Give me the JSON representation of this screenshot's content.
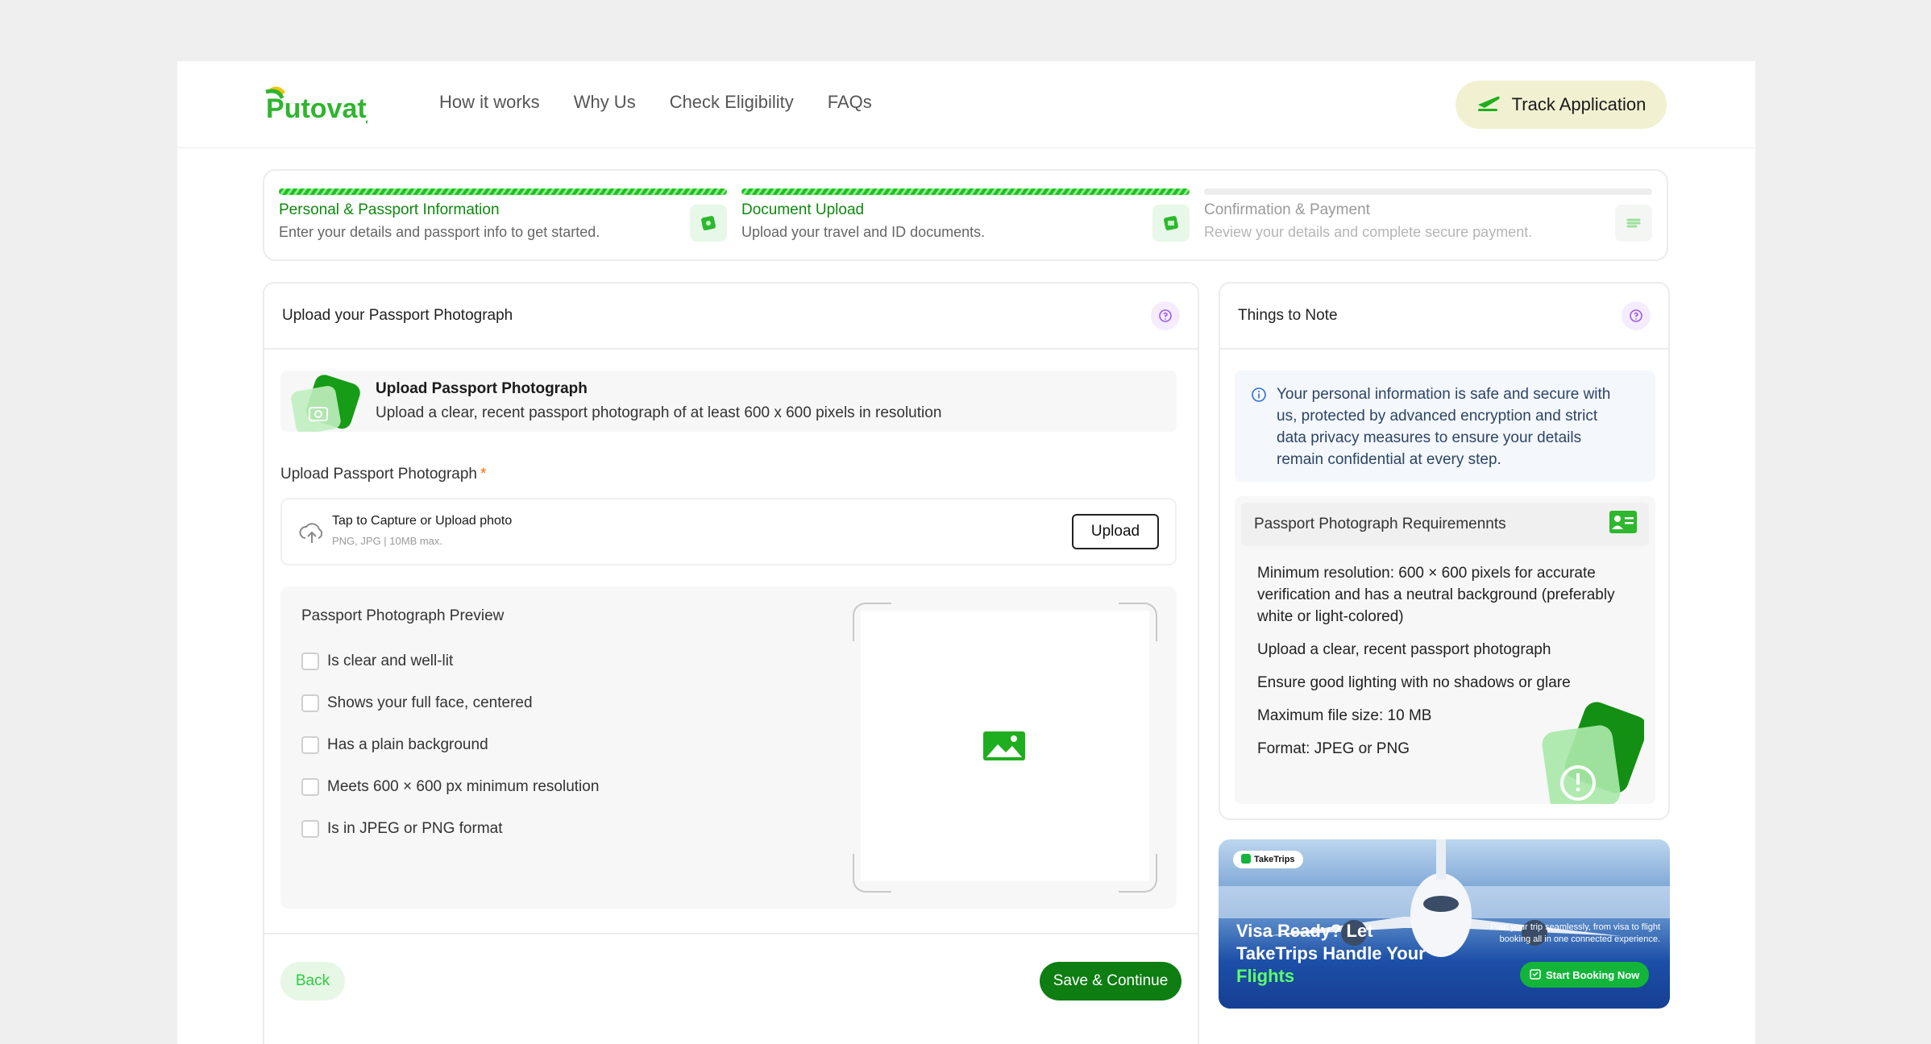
{
  "brand": {
    "logo_text": "Putovatj"
  },
  "nav": {
    "items": [
      "How it works",
      "Why Us",
      "Check Eligibility",
      "FAQs"
    ],
    "track_label": "Track Application"
  },
  "steps": [
    {
      "title": "Personal & Passport Information",
      "desc": "Enter your details and passport info to get started.",
      "state": "done"
    },
    {
      "title": "Document Upload",
      "desc": "Upload your travel and ID documents.",
      "state": "active"
    },
    {
      "title": "Confirmation & Payment",
      "desc": "Review your details and complete secure payment.",
      "state": "pending"
    }
  ],
  "upload_card": {
    "title": "Upload your Passport Photograph",
    "banner_title": "Upload Passport Photograph",
    "banner_desc": "Upload a clear, recent passport photograph of at least 600 x 600 pixels in resolution",
    "field_label": "Upload Passport Photograph",
    "required_mark": "*",
    "drop_title": "Tap to Capture or Upload photo",
    "drop_hint": "PNG, JPG | 10MB max.",
    "upload_label": "Upload",
    "preview_title": "Passport Photograph Preview",
    "checklist": [
      "Is clear and well-lit",
      "Shows your full face, centered",
      "Has a plain background",
      "Meets 600 × 600 px minimum resolution",
      "Is in JPEG or PNG format"
    ],
    "back_label": "Back",
    "save_label": "Save & Continue"
  },
  "notes_card": {
    "title": "Things to Note",
    "security_note": "Your personal information is safe and secure with us, protected by advanced encryption and strict data privacy measures to ensure your details remain confidential at every step.",
    "requirements_title": "Passport Photograph Requiremennts",
    "requirements": [
      {
        "label": "Minimum resolution: ",
        "value": "600 × 600",
        "rest": " pixels for accurate verification and has a neutral background (preferably white or light-colored)"
      },
      {
        "label": "Upload a clear, recent passport photograph",
        "value": "",
        "rest": ""
      },
      {
        "label": "Ensure good lighting with no shadows or glare",
        "value": "",
        "rest": ""
      },
      {
        "label": "Maximum file size: ",
        "value": "10 MB",
        "rest": ""
      },
      {
        "label": "Format: ",
        "value": "JPEG or PNG",
        "rest": ""
      }
    ]
  },
  "ad": {
    "brand": "TakeTrips",
    "headline_1": "Visa Ready? Let TakeTrips Handle Your ",
    "headline_2": "Flights",
    "sub": "Plan your trip seamlessly, from visa to flight booking all in one connected experience.",
    "cta": "Start Booking Now"
  },
  "colors": {
    "accent": "#0e7d12",
    "accent_light": "#2ecc40",
    "track_bg": "#f1f1d2"
  }
}
